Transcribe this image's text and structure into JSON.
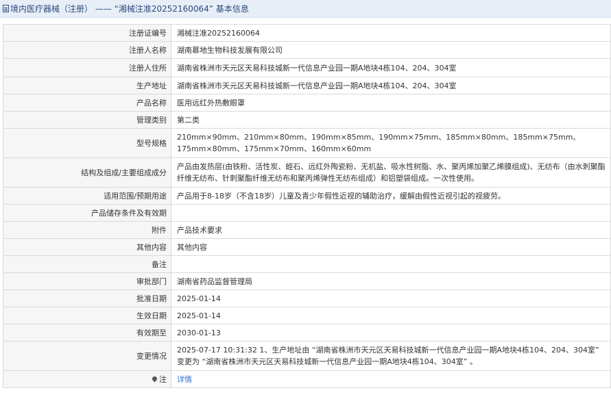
{
  "header": {
    "title": "境内医疗器械（注册） —— “湘械注准20252160064” 基本信息",
    "icon": "document-icon"
  },
  "rows": [
    {
      "label": "注册证编号",
      "value": "湘械注准20252160064"
    },
    {
      "label": "注册人名称",
      "value": "湖南慕地生物科技发展有限公司"
    },
    {
      "label": "注册人住所",
      "value": "湖南省株洲市天元区天易科技城新一代信息产业园一期A地块4栋104、204、304室"
    },
    {
      "label": "生产地址",
      "value": "湖南省株洲市天元区天易科技城新一代信息产业园一期A地块4栋104、204、304室"
    },
    {
      "label": "产品名称",
      "value": "医用远红外热敷眼罩"
    },
    {
      "label": "管理类别",
      "value": "第二类"
    },
    {
      "label": "型号规格",
      "value": "210mm×90mm、210mm×80mm、190mm×85mm、190mm×75mm、185mm×80mm、185mm×75mm、175mm×80mm、175mm×70mm、160mm×60mm"
    },
    {
      "label": "结构及组成/主要组成成分",
      "value": "产品由发热层(由铁粉、活性炭、蛭石、远红外陶瓷粉、无机盐、吸水性树脂、水、聚丙烯加聚乙烯膜组成)、无纺布（由水刺聚酯纤维无纺布、针刺聚酯纤维无纺布和聚丙烯弹性无纺布组成）和铝塑袋组成。一次性使用。"
    },
    {
      "label": "适用范围/预期用途",
      "value": "产品用于8-18岁（不含18岁）儿童及青少年假性近视的辅助治疗，缓解由假性近视引起的视疲劳。"
    },
    {
      "label": "产品储存条件及有效期",
      "value": ""
    },
    {
      "label": "附件",
      "value": "产品技术要求"
    },
    {
      "label": "其他内容",
      "value": "其他内容"
    },
    {
      "label": "备注",
      "value": ""
    },
    {
      "label": "审批部门",
      "value": "湖南省药品监督管理局"
    },
    {
      "label": "批准日期",
      "value": "2025-01-14"
    },
    {
      "label": "生效日期",
      "value": "2025-01-14"
    },
    {
      "label": "有效期至",
      "value": "2030-01-13"
    },
    {
      "label": "变更情况",
      "value": "2025-07-17 10:31:32 1、生产地址由 “湖南省株洲市天元区天易科技城新一代信息产业园一期A地块4栋104、204、304室” 变更为 “湖南省株洲市天元区天易科技城新一代信息产业园一期A地块4栋104、304室” 。"
    },
    {
      "label": "注",
      "value": "详情",
      "icon": "location-pin-icon"
    }
  ]
}
